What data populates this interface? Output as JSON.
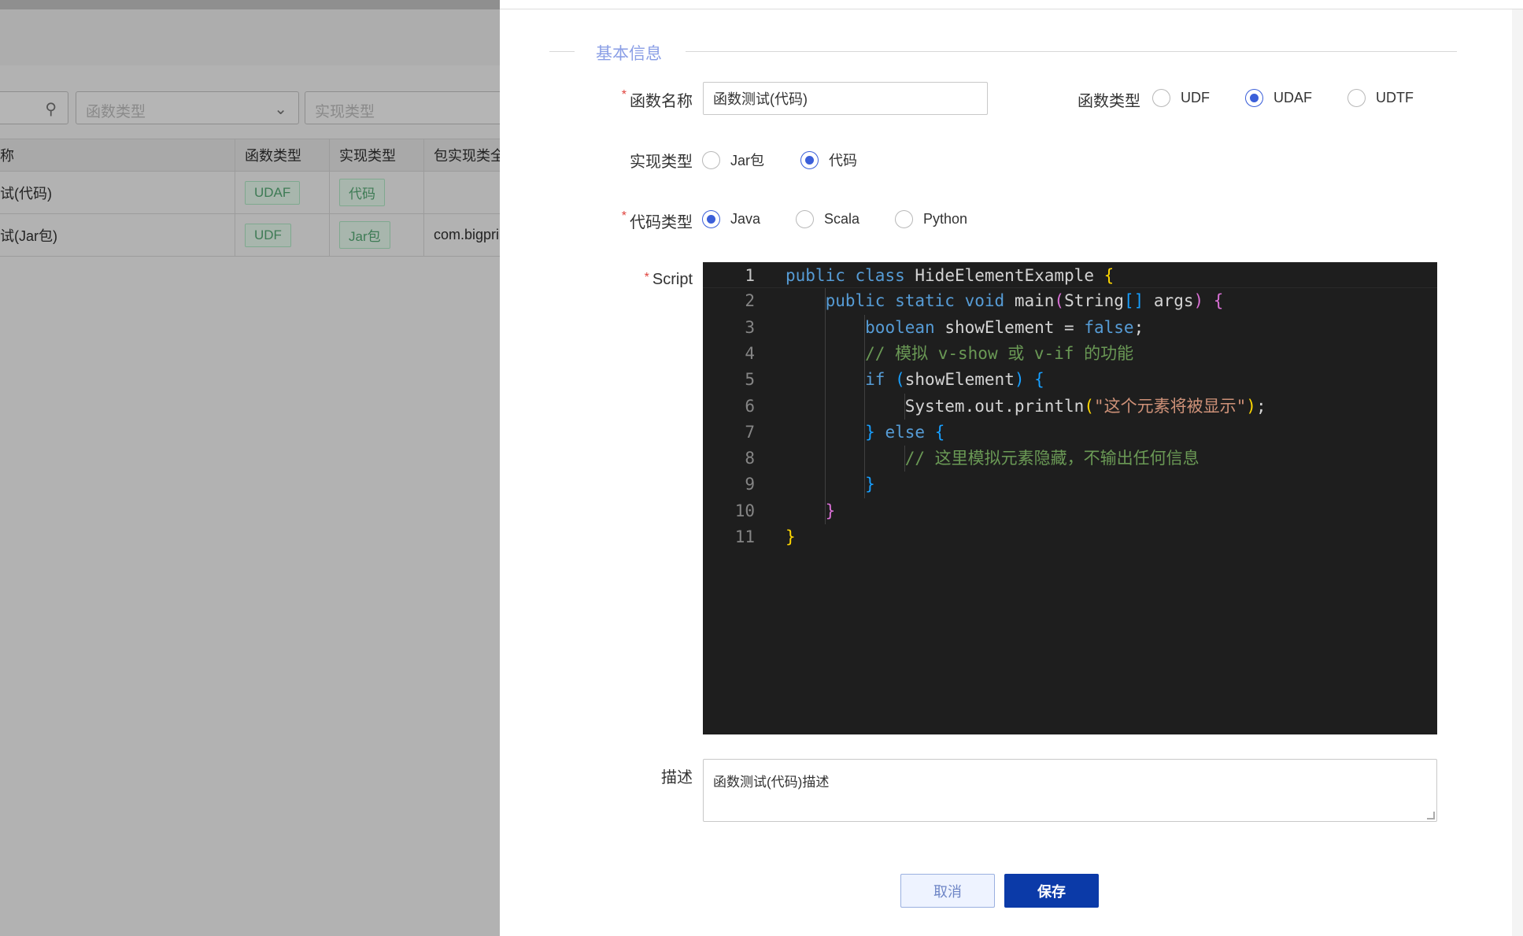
{
  "background": {
    "search": {
      "icon": "search-icon"
    },
    "filters": {
      "function_type_placeholder": "函数类型",
      "impl_type_placeholder": "实现类型"
    },
    "table": {
      "headers": [
        "称",
        "函数类型",
        "实现类型",
        "包实现类全"
      ],
      "rows": [
        {
          "name": "试(代码)",
          "function_type": "UDAF",
          "impl_type": "代码",
          "package": ""
        },
        {
          "name": "试(Jar包)",
          "function_type": "UDF",
          "impl_type": "Jar包",
          "package": "com.bigpri"
        }
      ]
    }
  },
  "drawer": {
    "section_title": "基本信息",
    "fields": {
      "name": {
        "label": "函数名称",
        "value": "函数测试(代码)"
      },
      "function_type": {
        "label": "函数类型",
        "options": [
          "UDF",
          "UDAF",
          "UDTF"
        ],
        "selected": "UDAF"
      },
      "impl_type": {
        "label": "实现类型",
        "options": [
          "Jar包",
          "代码"
        ],
        "selected": "代码"
      },
      "code_type": {
        "label": "代码类型",
        "options": [
          "Java",
          "Scala",
          "Python"
        ],
        "selected": "Java"
      },
      "script": {
        "label": "Script"
      },
      "description": {
        "label": "描述",
        "value": "函数测试(代码)描述"
      }
    },
    "editor": {
      "line_numbers": [
        "1",
        "2",
        "3",
        "4",
        "5",
        "6",
        "7",
        "8",
        "9",
        "10",
        "11"
      ],
      "active_line": 1,
      "lines": [
        "public class HideElementExample {",
        "    public static void main(String[] args) {",
        "        boolean showElement = false;",
        "        // 模拟 v-show 或 v-if 的功能",
        "        if (showElement) {",
        "            System.out.println(\"这个元素将被显示\");",
        "        } else {",
        "            // 这里模拟元素隐藏，不输出任何信息",
        "        }",
        "    }",
        "}"
      ]
    },
    "buttons": {
      "cancel": "取消",
      "save": "保存"
    },
    "required_mark": "*",
    "colors": {
      "primary": "#0b3aa8",
      "radio_checked": "#3b5fd9",
      "section_title": "#8b9fe6",
      "editor_bg": "#1e1e1e"
    }
  }
}
